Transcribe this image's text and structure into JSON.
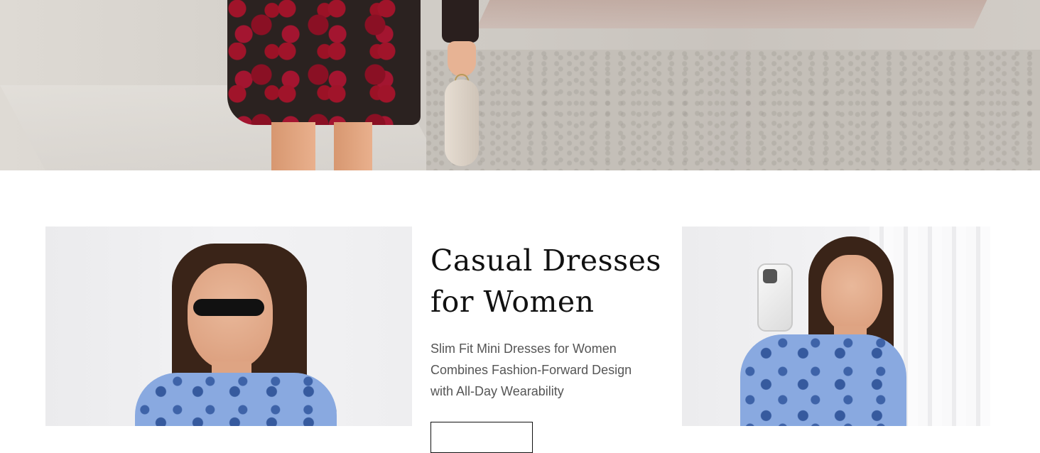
{
  "hero": {
    "image_alt": "Woman in red floral mini dress holding a pale beaded clutch on a city sidewalk"
  },
  "promo": {
    "headline_line1": "Casual Dresses",
    "headline_line2": "for Women",
    "subtitle_line1": "Slim Fit Mini Dresses for Women",
    "subtitle_line2": "Combines Fashion-Forward Design",
    "subtitle_line3": "with All-Day Wearability",
    "cta_label": ""
  },
  "images": {
    "left_alt": "Model in blue floral long-sleeve mini dress wearing black sunglasses",
    "right_alt": "Model in blue floral long-sleeve mini dress taking a mirror selfie with a phone"
  },
  "colors": {
    "text_primary": "#111111",
    "text_secondary": "#555555",
    "dress_red": "#a0142a",
    "dress_blue": "#89a9e0"
  }
}
